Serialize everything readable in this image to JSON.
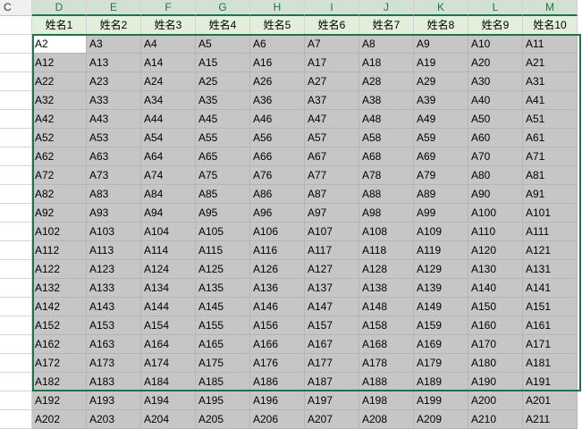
{
  "column_headers": [
    "C",
    "D",
    "E",
    "F",
    "G",
    "H",
    "I",
    "J",
    "K",
    "L",
    "M"
  ],
  "header_row": [
    "姓名1",
    "姓名2",
    "姓名3",
    "姓名4",
    "姓名5",
    "姓名6",
    "姓名7",
    "姓名8",
    "姓名9",
    "姓名10"
  ],
  "rows": [
    [
      "A2",
      "A3",
      "A4",
      "A5",
      "A6",
      "A7",
      "A8",
      "A9",
      "A10",
      "A11"
    ],
    [
      "A12",
      "A13",
      "A14",
      "A15",
      "A16",
      "A17",
      "A18",
      "A19",
      "A20",
      "A21"
    ],
    [
      "A22",
      "A23",
      "A24",
      "A25",
      "A26",
      "A27",
      "A28",
      "A29",
      "A30",
      "A31"
    ],
    [
      "A32",
      "A33",
      "A34",
      "A35",
      "A36",
      "A37",
      "A38",
      "A39",
      "A40",
      "A41"
    ],
    [
      "A42",
      "A43",
      "A44",
      "A45",
      "A46",
      "A47",
      "A48",
      "A49",
      "A50",
      "A51"
    ],
    [
      "A52",
      "A53",
      "A54",
      "A55",
      "A56",
      "A57",
      "A58",
      "A59",
      "A60",
      "A61"
    ],
    [
      "A62",
      "A63",
      "A64",
      "A65",
      "A66",
      "A67",
      "A68",
      "A69",
      "A70",
      "A71"
    ],
    [
      "A72",
      "A73",
      "A74",
      "A75",
      "A76",
      "A77",
      "A78",
      "A79",
      "A80",
      "A81"
    ],
    [
      "A82",
      "A83",
      "A84",
      "A85",
      "A86",
      "A87",
      "A88",
      "A89",
      "A90",
      "A91"
    ],
    [
      "A92",
      "A93",
      "A94",
      "A95",
      "A96",
      "A97",
      "A98",
      "A99",
      "A100",
      "A101"
    ],
    [
      "A102",
      "A103",
      "A104",
      "A105",
      "A106",
      "A107",
      "A108",
      "A109",
      "A110",
      "A111"
    ],
    [
      "A112",
      "A113",
      "A114",
      "A115",
      "A116",
      "A117",
      "A118",
      "A119",
      "A120",
      "A121"
    ],
    [
      "A122",
      "A123",
      "A124",
      "A125",
      "A126",
      "A127",
      "A128",
      "A129",
      "A130",
      "A131"
    ],
    [
      "A132",
      "A133",
      "A134",
      "A135",
      "A136",
      "A137",
      "A138",
      "A139",
      "A140",
      "A141"
    ],
    [
      "A142",
      "A143",
      "A144",
      "A145",
      "A146",
      "A147",
      "A148",
      "A149",
      "A150",
      "A151"
    ],
    [
      "A152",
      "A153",
      "A154",
      "A155",
      "A156",
      "A157",
      "A158",
      "A159",
      "A160",
      "A161"
    ],
    [
      "A162",
      "A163",
      "A164",
      "A165",
      "A166",
      "A167",
      "A168",
      "A169",
      "A170",
      "A171"
    ],
    [
      "A172",
      "A173",
      "A174",
      "A175",
      "A176",
      "A177",
      "A178",
      "A179",
      "A180",
      "A181"
    ],
    [
      "A182",
      "A183",
      "A184",
      "A185",
      "A186",
      "A187",
      "A188",
      "A189",
      "A190",
      "A191"
    ],
    [
      "A192",
      "A193",
      "A194",
      "A195",
      "A196",
      "A197",
      "A198",
      "A199",
      "A200",
      "A201"
    ],
    [
      "A202",
      "A203",
      "A204",
      "A205",
      "A206",
      "A207",
      "A208",
      "A209",
      "A210",
      "A211"
    ]
  ],
  "colors": {
    "selection_border": "#217346",
    "selected_header_bg": "#d2e1d4",
    "name_row_bg": "#e2efda",
    "selected_fill": "#c6c6c6",
    "active_cell_bg": "#ffffff"
  }
}
